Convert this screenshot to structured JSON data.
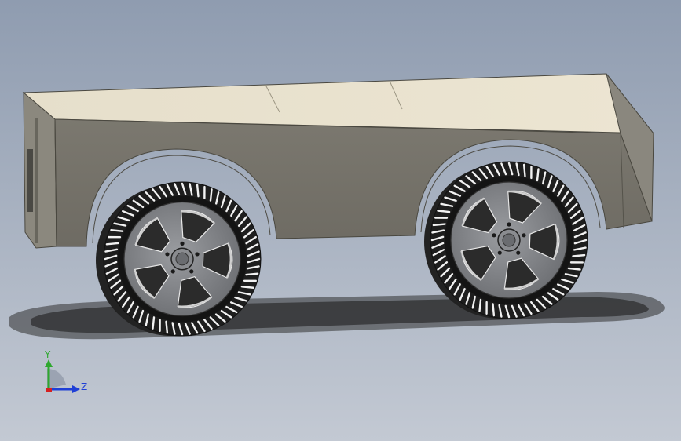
{
  "viewport": {
    "background_top": "#8f9cb0",
    "background_bottom": "#c3c9d3"
  },
  "model": {
    "body_top_color": "#e8e0cc",
    "body_side_color": "#76736a",
    "body_front_color": "#8b887e",
    "wheel_rim_color": "#7a7c80",
    "tire_color": "#1e1e1e",
    "tread_color": "#f2f2f2"
  },
  "triad": {
    "y_label": "Y",
    "z_label": "Z",
    "y_color": "#2ea82e",
    "z_color": "#1f3fd6",
    "x_color": "#d62020"
  }
}
